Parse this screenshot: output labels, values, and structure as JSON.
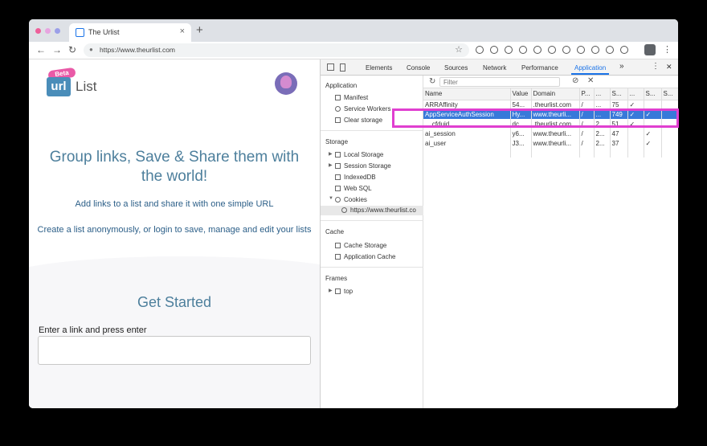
{
  "browser": {
    "tab_title": "The Urlist",
    "tab_close": "×",
    "new_tab": "+",
    "url": "https://www.theurlist.com",
    "nav": {
      "back": "←",
      "forward": "→",
      "reload": "↻"
    },
    "star": "☆",
    "menu": "⋮"
  },
  "page": {
    "logo_badge": "Beta",
    "logo_box": "url",
    "logo_text": "List",
    "headline": "Group links, Save & Share them with the world!",
    "subtext1": "Add links to a list and share it with one simple URL",
    "subtext2": "Create a list anonymously, or login to save, manage and edit your lists",
    "get_started": "Get Started",
    "link_label": "Enter a link and press enter",
    "link_value": ""
  },
  "devtools": {
    "tabs": [
      "Elements",
      "Console",
      "Sources",
      "Network",
      "Performance",
      "Application"
    ],
    "more_tabs": "»",
    "menu": "⋮",
    "close": "✕",
    "sidebar": {
      "application_header": "Application",
      "application_items": [
        "Manifest",
        "Service Workers",
        "Clear storage"
      ],
      "storage_header": "Storage",
      "storage_items": [
        "Local Storage",
        "Session Storage",
        "IndexedDB",
        "Web SQL",
        "Cookies"
      ],
      "cookie_origin": "https://www.theurlist.co",
      "cache_header": "Cache",
      "cache_items": [
        "Cache Storage",
        "Application Cache"
      ],
      "frames_header": "Frames",
      "frames_items": [
        "top"
      ]
    },
    "filter_placeholder": "Filter",
    "columns": [
      "Name",
      "Value",
      "Domain",
      "P...",
      "...",
      "S...",
      "...",
      "S...",
      "S..."
    ],
    "rows": [
      [
        "ARRAffinity",
        "54...",
        ".theurlist.com",
        "/",
        "...",
        "75",
        "✓",
        "",
        ""
      ],
      [
        "AppServiceAuthSession",
        "Hy...",
        "www.theurli...",
        "/",
        "...",
        "749",
        "✓",
        "✓",
        ""
      ],
      [
        "__cfduid",
        "dc...",
        ".theurlist.com",
        "/",
        "2...",
        "51",
        "✓",
        "",
        ""
      ],
      [
        "ai_session",
        "y6...",
        "www.theurli...",
        "/",
        "2...",
        "47",
        "",
        "✓",
        ""
      ],
      [
        "ai_user",
        "J3...",
        "www.theurli...",
        "/",
        "2...",
        "37",
        "",
        "✓",
        ""
      ]
    ]
  },
  "colors": {
    "highlight": "#e03fd0",
    "selected_row": "#3879d9",
    "accent": "#1a73e8"
  }
}
